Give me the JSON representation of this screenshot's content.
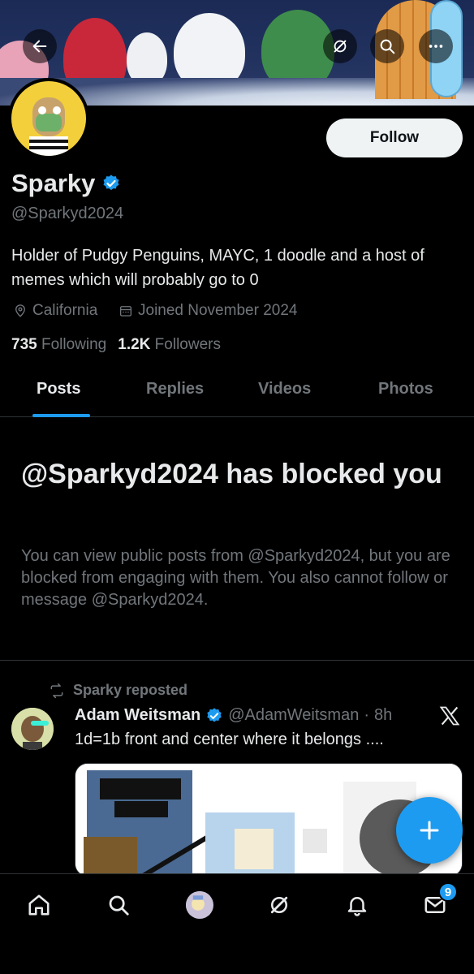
{
  "colors": {
    "accent": "#1d9bf0",
    "text_primary": "#e7e9ea",
    "text_secondary": "#71767b",
    "background": "#000000"
  },
  "header": {
    "back_icon": "arrow-left-icon",
    "grok_icon": "grok-icon",
    "search_icon": "search-icon",
    "more_icon": "more-horizontal-icon"
  },
  "profile": {
    "follow_label": "Follow",
    "name": "Sparky",
    "handle": "@Sparkyd2024",
    "bio": "Holder of Pudgy Penguins, MAYC, 1 doodle and a host of memes which will probably go to 0",
    "location": "California",
    "joined": "Joined November 2024",
    "following_count": "735",
    "following_label": "Following",
    "followers_count": "1.2K",
    "followers_label": "Followers"
  },
  "tabs": [
    {
      "label": "Posts",
      "active": true
    },
    {
      "label": "Replies",
      "active": false
    },
    {
      "label": "Videos",
      "active": false
    },
    {
      "label": "Photos",
      "active": false
    }
  ],
  "blocked": {
    "title": "@Sparkyd2024 has blocked you",
    "body": "You can view public posts from @Sparkyd2024, but you are blocked from engaging with them. You also cannot follow or message @Sparkyd2024."
  },
  "post": {
    "repost_label": "Sparky reposted",
    "author_name": "Adam Weitsman",
    "author_handle": "@AdamWeitsman",
    "separator": "·",
    "time": "8h",
    "text": "1d=1b front and center where it belongs ...."
  },
  "bottom_nav": {
    "items": [
      "home-icon",
      "search-icon",
      "communities-avatar",
      "grok-icon",
      "notifications-icon",
      "messages-icon"
    ],
    "messages_badge": "9"
  }
}
